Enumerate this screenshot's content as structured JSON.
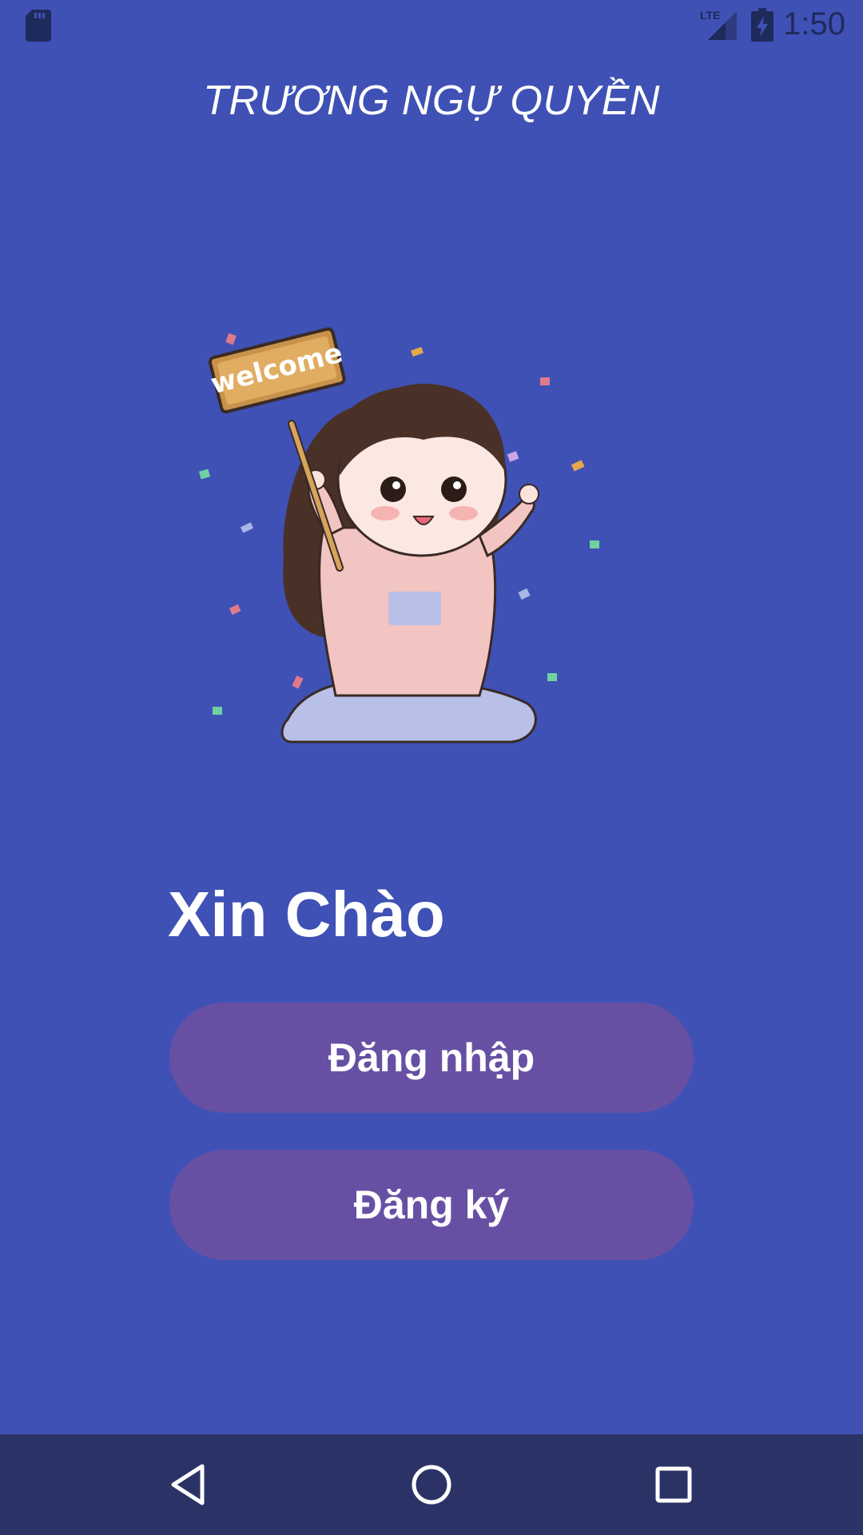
{
  "status_bar": {
    "time": "1:50",
    "icons": [
      "sd-card-icon",
      "lte-signal-icon",
      "battery-charging-icon"
    ],
    "network_label": "LTE"
  },
  "header": {
    "title": "TRƯƠNG NGỰ QUYỀN"
  },
  "illustration": {
    "sign_text": "welcome"
  },
  "main": {
    "greeting": "Xin Chào",
    "login_label": "Đăng nhập",
    "register_label": "Đăng ký"
  },
  "navigation_bar": {
    "icons": [
      "back-icon",
      "home-icon",
      "recents-icon"
    ]
  },
  "colors": {
    "background": "#3f51b5",
    "button": "#6750a4",
    "nav_bar": "#2b3366",
    "text": "#ffffff"
  }
}
